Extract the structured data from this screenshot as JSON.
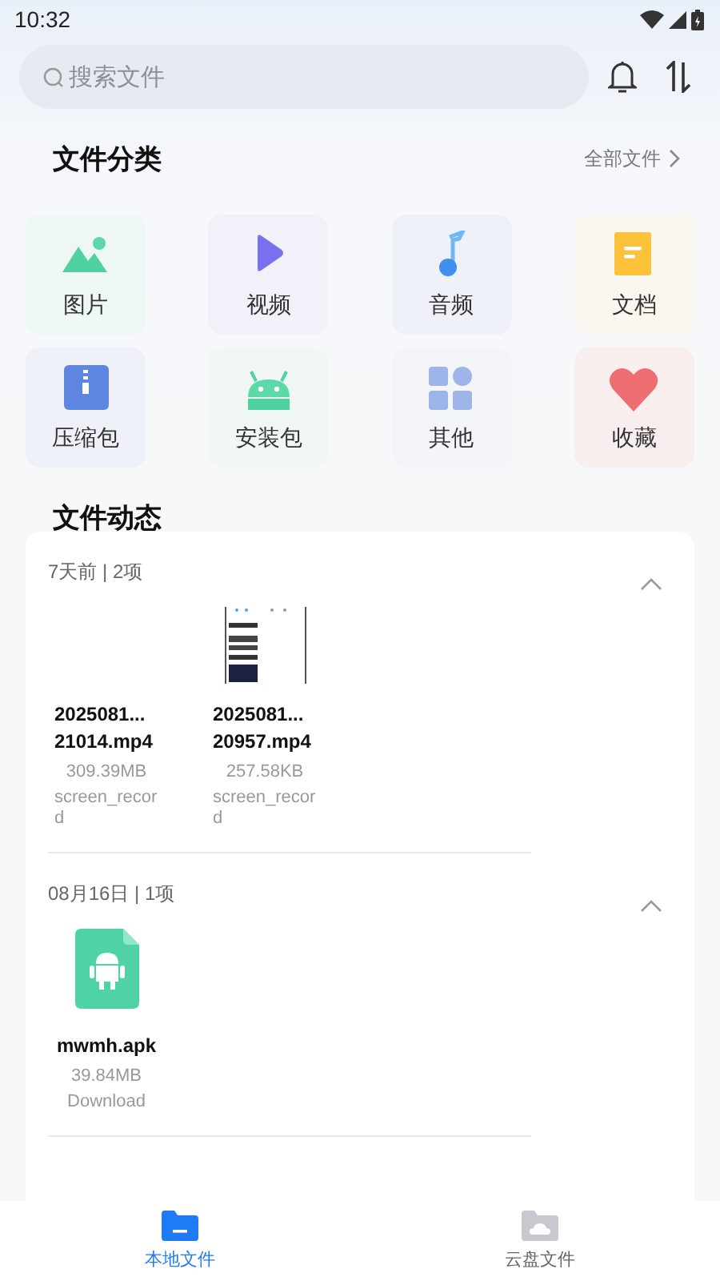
{
  "status_bar": {
    "time": "10:32"
  },
  "search": {
    "placeholder": "搜索文件"
  },
  "categories_header": {
    "title": "文件分类",
    "link": "全部文件"
  },
  "categories": [
    {
      "kind": "image",
      "label": "图片",
      "color": "#eef7f3"
    },
    {
      "kind": "video",
      "label": "视频",
      "color": "#f1f1f9"
    },
    {
      "kind": "audio",
      "label": "音频",
      "color": "#eef2f8"
    },
    {
      "kind": "document",
      "label": "文档",
      "color": "#faf7f0"
    },
    {
      "kind": "archive",
      "label": "压缩包",
      "color": "#eef2f8"
    },
    {
      "kind": "apk",
      "label": "安装包",
      "color": "#f1f7f4"
    },
    {
      "kind": "other",
      "label": "其他",
      "color": "#f3f5f8"
    },
    {
      "kind": "favorite",
      "label": "收藏",
      "color": "#f9eeee"
    }
  ],
  "activity": {
    "title": "文件动态",
    "groups": [
      {
        "header": "7天前 | 2项",
        "expanded": true,
        "files": [
          {
            "kind": "blank",
            "name": "2025081...\n21014.mp4",
            "size": "309.39MB",
            "folder": "screen_record"
          },
          {
            "kind": "screenshot",
            "name": "2025081...\n20957.mp4",
            "size": "257.58KB",
            "folder": "screen_record"
          }
        ]
      },
      {
        "header": "08月16日 | 1项",
        "expanded": true,
        "files": [
          {
            "kind": "apk",
            "name": "mwmh.apk",
            "size": "39.84MB",
            "folder": "Download"
          }
        ]
      }
    ]
  },
  "bottom_nav": [
    {
      "kind": "local",
      "label": "本地文件",
      "selected": true
    },
    {
      "kind": "cloud",
      "label": "云盘文件",
      "selected": false
    }
  ]
}
